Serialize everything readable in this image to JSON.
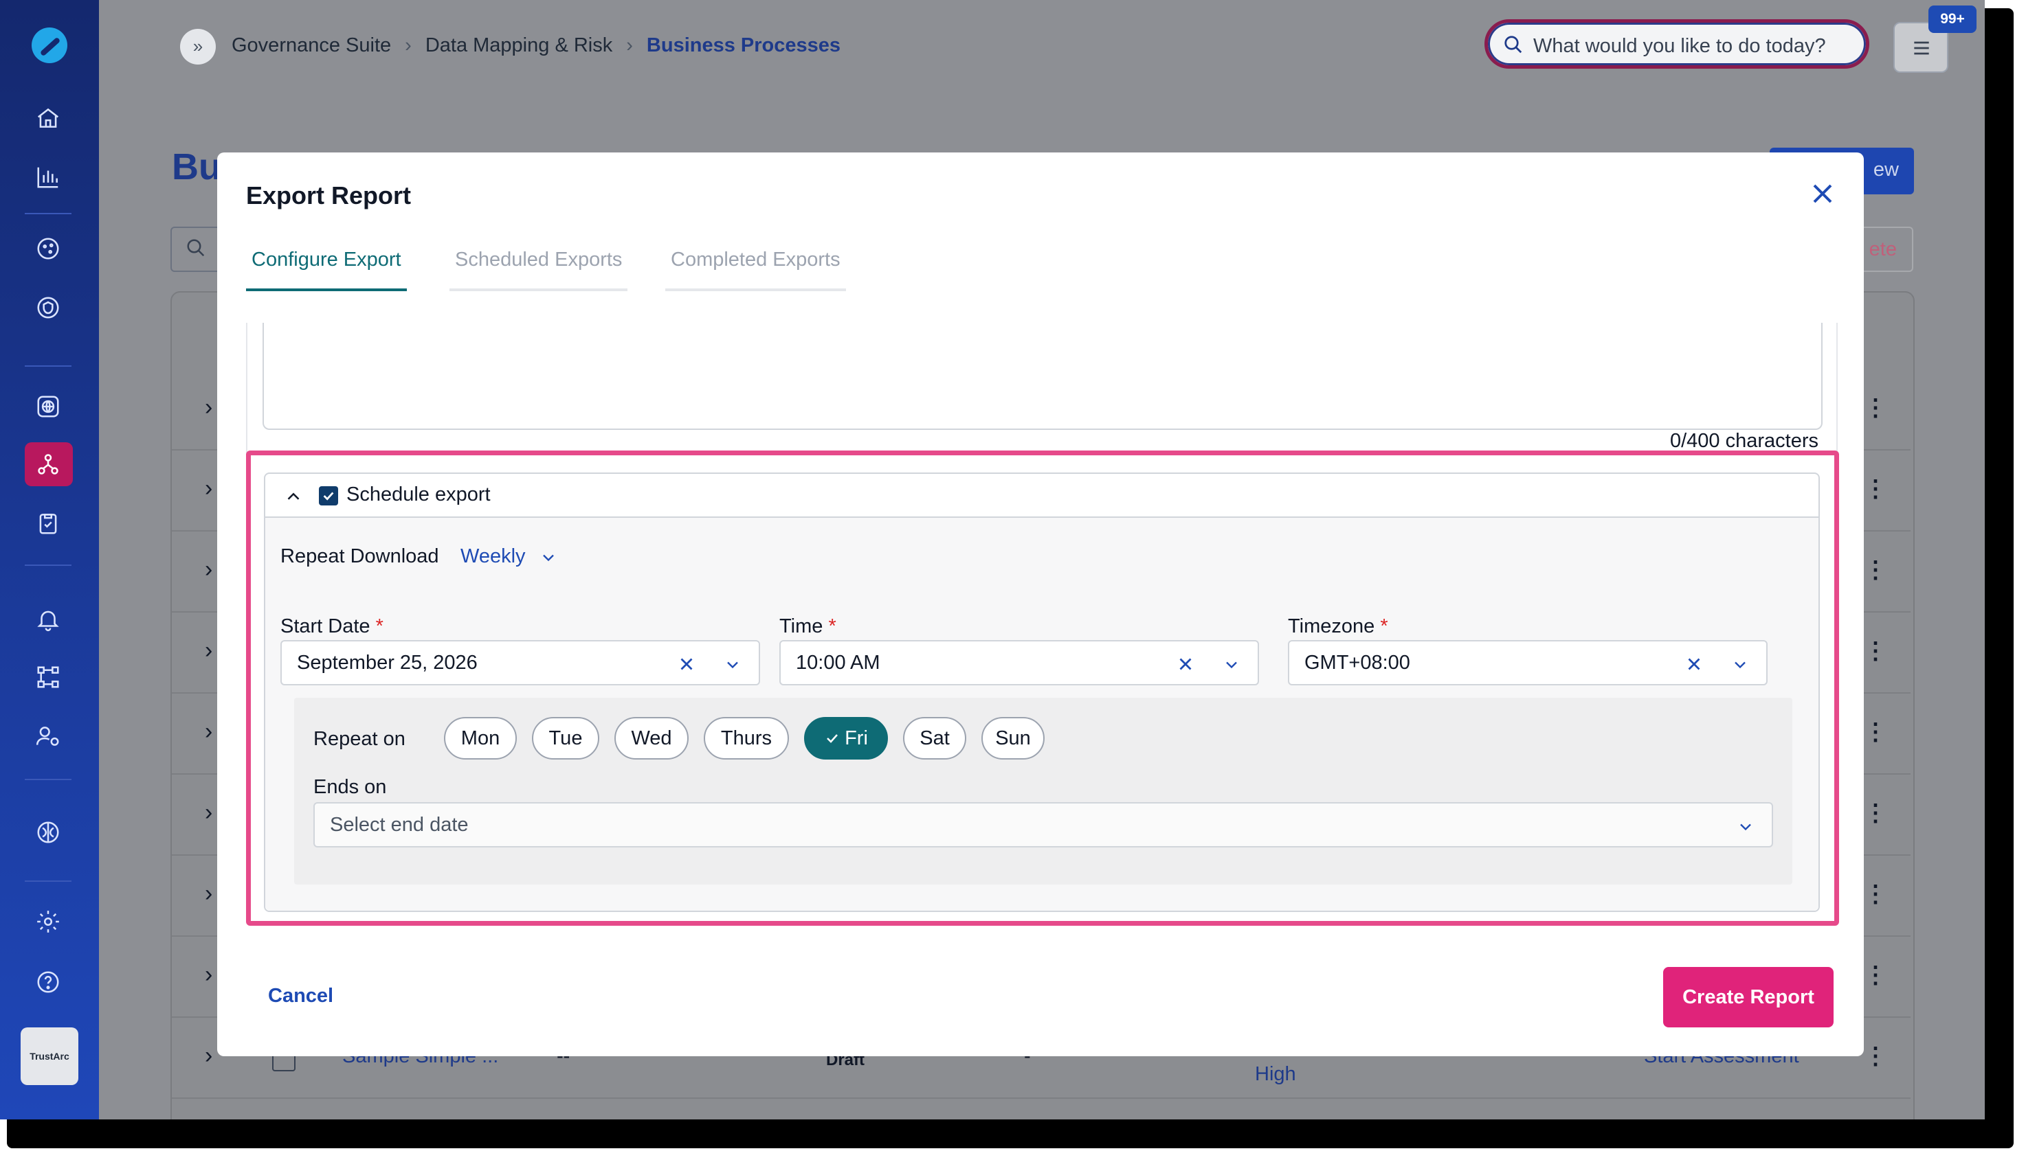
{
  "topbar": {
    "breadcrumb": [
      "Governance Suite",
      "Data Mapping & Risk",
      "Business Processes"
    ],
    "search_placeholder": "What would you like to do today?",
    "notifications_badge": "99+"
  },
  "sidebar": {
    "brand_label": "TrustArc",
    "icons": [
      "home-icon",
      "bar-chart-icon",
      "cookie-icon",
      "privacy-shield-icon",
      "globe-icon",
      "network-icon",
      "clipboard-check-icon",
      "bell-icon",
      "workflow-icon",
      "user-gear-icon",
      "brain-icon",
      "gear-icon",
      "help-icon"
    ],
    "active_icon": "network-icon"
  },
  "background": {
    "page_title": "Bu",
    "new_button": "ew",
    "delete_button": "ete",
    "last_row": {
      "name": "Sample Simple ...",
      "owner": "--",
      "status": "Draft",
      "dash": "-",
      "risk": "High",
      "action": "Start Assessment"
    }
  },
  "modal": {
    "title": "Export Report",
    "tabs": [
      "Configure Export",
      "Scheduled Exports",
      "Completed Exports"
    ],
    "active_tab": "Configure Export",
    "char_count": "0/400 characters",
    "schedule": {
      "label": "Schedule export",
      "checked": true,
      "repeat_download_label": "Repeat Download",
      "repeat_download_value": "Weekly",
      "start_date_label": "Start Date",
      "start_date_value": "September 25, 2026",
      "time_label": "Time",
      "time_value": "10:00 AM",
      "timezone_label": "Timezone",
      "timezone_value": "GMT+08:00",
      "required_mark": "*",
      "repeat_on_label": "Repeat on",
      "days": [
        "Mon",
        "Tue",
        "Wed",
        "Thurs",
        "Fri",
        "Sat",
        "Sun"
      ],
      "selected_day": "Fri",
      "ends_on_label": "Ends on",
      "ends_on_placeholder": "Select end date"
    },
    "cancel_label": "Cancel",
    "create_label": "Create Report"
  },
  "colors": {
    "accent_teal": "#0e6b75",
    "primary_blue": "#1e4bb4",
    "create_pink": "#e0237a",
    "highlight_pink": "#e64a8a",
    "sidebar_navy": "#14286e"
  }
}
